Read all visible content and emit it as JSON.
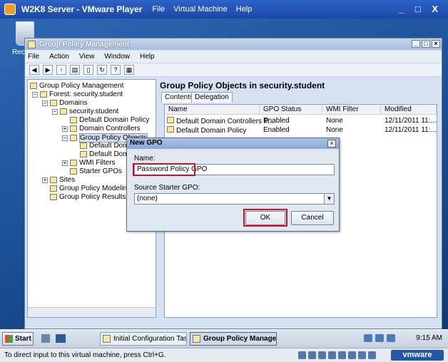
{
  "vm": {
    "title": "W2K8 Server - VMware Player",
    "menus": [
      "File",
      "Virtual Machine",
      "Help"
    ],
    "controls": "_ □ X"
  },
  "desktop": {
    "recycle_label": "Rec"
  },
  "gpmc": {
    "title": "Group Policy Management",
    "menus": [
      "File",
      "Action",
      "View",
      "Window",
      "Help"
    ],
    "tree": [
      {
        "label": "Group Policy Management",
        "level": 0
      },
      {
        "label": "Forest: security.student",
        "level": 1,
        "toggle": "−"
      },
      {
        "label": "Domains",
        "level": 2,
        "toggle": "−"
      },
      {
        "label": "security.student",
        "level": 3,
        "toggle": "−"
      },
      {
        "label": "Default Domain Policy",
        "level": 4
      },
      {
        "label": "Domain Controllers",
        "level": 4,
        "toggle": "+"
      },
      {
        "label": "Group Policy Objects",
        "level": 4,
        "toggle": "−",
        "selected": true
      },
      {
        "label": "Default Doma",
        "level": 5
      },
      {
        "label": "Default Doma",
        "level": 5
      },
      {
        "label": "WMI Filters",
        "level": 4,
        "toggle": "+"
      },
      {
        "label": "Starter GPOs",
        "level": 4
      },
      {
        "label": "Sites",
        "level": 2,
        "toggle": "+"
      },
      {
        "label": "Group Policy Modeling",
        "level": 2
      },
      {
        "label": "Group Policy Results",
        "level": 2
      }
    ],
    "pane_title": "Group Policy Objects in security.student",
    "tabs": [
      "Contents",
      "Delegation"
    ],
    "columns": [
      "Name",
      "GPO Status",
      "WMI Filter",
      "Modified"
    ],
    "rows": [
      [
        "Default Domain Controllers P...",
        "Enabled",
        "None",
        "12/11/2011 11:..."
      ],
      [
        "Default Domain Policy",
        "Enabled",
        "None",
        "12/11/2011 11:..."
      ]
    ]
  },
  "dialog": {
    "title": "New GPO",
    "name_label": "Name:",
    "name_value": "Password Policy GPO",
    "starter_label": "Source Starter GPO:",
    "starter_value": "(none)",
    "ok_label": "OK",
    "cancel_label": "Cancel"
  },
  "taskbar": {
    "start_label": "Start",
    "tasks": [
      "Initial Configuration Tasks",
      "Group Policy Manage..."
    ],
    "clock": "9:15 AM"
  },
  "status": {
    "text": "To direct input to this virtual machine, press Ctrl+G.",
    "brand": "vmware"
  }
}
